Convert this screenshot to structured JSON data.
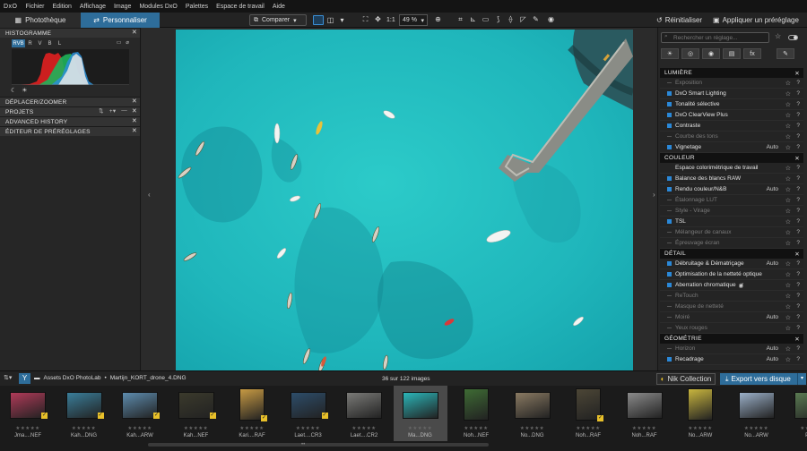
{
  "app": {
    "logo": "DxO"
  },
  "menu": [
    "Fichier",
    "Edition",
    "Affichage",
    "Image",
    "Modules DxO",
    "Palettes",
    "Espace de travail",
    "Aide"
  ],
  "tabs": {
    "library": "Photothèque",
    "customize": "Personnaliser"
  },
  "toolbar": {
    "compare": "Comparer",
    "ratio": "1:1",
    "zoom": "49 %",
    "reset": "Réinitialiser",
    "apply_preset": "Appliquer un préréglage"
  },
  "left_panel": {
    "histogram_title": "HISTOGRAMME",
    "channels": [
      "RVB",
      "R",
      "V",
      "B",
      "L"
    ],
    "sections": [
      "DÉPLACER/ZOOMER",
      "PROJETS",
      "ADVANCED HISTORY",
      "ÉDITEUR DE PRÉRÉGLAGES"
    ],
    "project_tools": [
      "⇅",
      "+▾",
      "—"
    ]
  },
  "right_panel": {
    "search_placeholder": "Rechercher un réglage...",
    "palette_icons": [
      "☀",
      "◎",
      "◉",
      "▤",
      "fx",
      "✎"
    ],
    "sections": [
      {
        "title": "LUMIÈRE",
        "items": [
          {
            "label": "Exposition",
            "on": false,
            "auto": ""
          },
          {
            "label": "DxO Smart Lighting",
            "on": true,
            "auto": ""
          },
          {
            "label": "Tonalité sélective",
            "on": true,
            "auto": ""
          },
          {
            "label": "DxO ClearView Plus",
            "on": true,
            "auto": ""
          },
          {
            "label": "Contraste",
            "on": true,
            "auto": ""
          },
          {
            "label": "Courbe des tons",
            "on": false,
            "auto": ""
          },
          {
            "label": "Vignetage",
            "on": true,
            "auto": "Auto"
          }
        ]
      },
      {
        "title": "COULEUR",
        "items": [
          {
            "label": "Espace colorimétrique de travail",
            "on": true,
            "auto": "",
            "nocb": true
          },
          {
            "label": "Balance des blancs RAW",
            "on": true,
            "auto": ""
          },
          {
            "label": "Rendu couleur/N&B",
            "on": true,
            "auto": "Auto"
          },
          {
            "label": "Étalonnage LUT",
            "on": false,
            "auto": ""
          },
          {
            "label": "Style - Virage",
            "on": false,
            "auto": ""
          },
          {
            "label": "TSL",
            "on": true,
            "auto": ""
          },
          {
            "label": "Mélangeur de canaux",
            "on": false,
            "auto": ""
          },
          {
            "label": "Épreuvage écran",
            "on": false,
            "auto": ""
          }
        ]
      },
      {
        "title": "DÉTAIL",
        "items": [
          {
            "label": "Débruitage & Dématriçage",
            "on": true,
            "auto": "Auto"
          },
          {
            "label": "Optimisation de la netteté optique",
            "on": true,
            "auto": ""
          },
          {
            "label": "Aberration chromatique",
            "on": true,
            "auto": "",
            "eye": true
          },
          {
            "label": "ReTouch",
            "on": false,
            "auto": ""
          },
          {
            "label": "Masque de netteté",
            "on": false,
            "auto": ""
          },
          {
            "label": "Moiré",
            "on": false,
            "auto": "Auto"
          },
          {
            "label": "Yeux rouges",
            "on": false,
            "auto": ""
          }
        ]
      },
      {
        "title": "GÉOMÉTRIE",
        "items": [
          {
            "label": "Horizon",
            "on": false,
            "auto": "Auto"
          },
          {
            "label": "Recadrage",
            "on": true,
            "auto": "Auto"
          }
        ]
      }
    ]
  },
  "filmbar": {
    "folder": "Assets DxO PhotoLab",
    "separator": "•",
    "file": "Martijn_KORT_drone_4.DNG",
    "count": "36 sur 122 images",
    "nik": "Nik Collection",
    "export": "Export vers disque"
  },
  "thumbnails": [
    {
      "name": "Jma....NEF",
      "color": "#b03a58",
      "check": true
    },
    {
      "name": "Kah...DNG",
      "color": "#3a7e9a",
      "check": true
    },
    {
      "name": "Kah...ARW",
      "color": "#5d8cae",
      "check": true
    },
    {
      "name": "Kah...NEF",
      "color": "#3b3a2c",
      "check": true
    },
    {
      "name": "Kari....RAF",
      "color": "#c79a43",
      "check": true
    },
    {
      "name": "Laet....CR3",
      "color": "#2d4d6a",
      "check": true
    },
    {
      "name": "Laet....CR2",
      "color": "#7b7b78",
      "check": false
    },
    {
      "name": "Ma...DNG",
      "color": "#2bb6b9",
      "check": false,
      "selected": true
    },
    {
      "name": "Noh...NEF",
      "color": "#3e6b34",
      "check": false
    },
    {
      "name": "No...DNG",
      "color": "#8a7a62",
      "check": false
    },
    {
      "name": "Noh...RAF",
      "color": "#4c4636",
      "check": true
    },
    {
      "name": "Noh...RAF",
      "color": "#8b8b8b",
      "check": false
    },
    {
      "name": "No...ARW",
      "color": "#c9b63e",
      "check": false
    },
    {
      "name": "No...ARW",
      "color": "#9bb0c8",
      "check": false
    },
    {
      "name": "Petr...",
      "color": "#5a7a52",
      "check": false
    }
  ],
  "film_stars": "★★★★★"
}
